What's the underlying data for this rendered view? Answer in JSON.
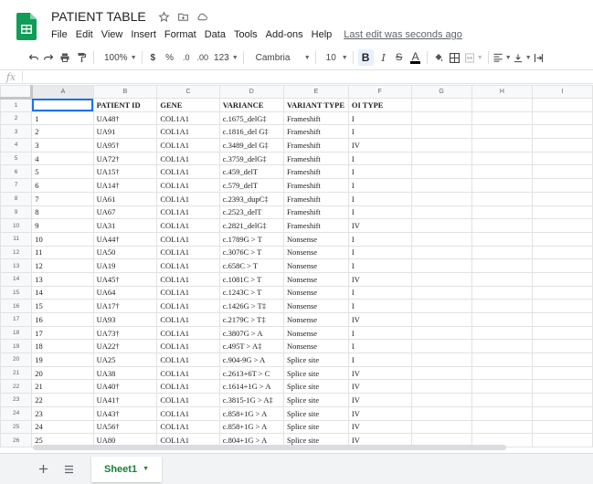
{
  "app": {
    "icon": "sheets-logo",
    "accent_color": "#0f9d58",
    "title": "PATIENT TABLE",
    "title_icons": [
      "star-icon",
      "folder-icon",
      "cloud-icon"
    ]
  },
  "menu": {
    "items": [
      "File",
      "Edit",
      "View",
      "Insert",
      "Format",
      "Data",
      "Tools",
      "Add-ons",
      "Help"
    ],
    "last_edit": "Last edit was seconds ago"
  },
  "toolbar": {
    "zoom": "100%",
    "currency": "$",
    "percent": "%",
    "decimal_decrease": ".0",
    "decimal_increase": ".00",
    "more_formats": "123",
    "font": "Cambria",
    "font_size": "10",
    "bold": "B",
    "italic": "I",
    "strikethrough": "S",
    "text_color": "A"
  },
  "formula_bar": {
    "fx": "fx",
    "value": ""
  },
  "grid": {
    "columns": [
      "A",
      "B",
      "C",
      "D",
      "E",
      "F",
      "G",
      "H",
      "I"
    ],
    "header_row": [
      "",
      "PATIENT ID",
      "GENE",
      "VARIANCE",
      "VARIANT TYPE",
      "OI TYPE"
    ],
    "rows": [
      [
        "1",
        "UA48†",
        "COL1A1",
        "c.1675_delG‡",
        "Frameshift",
        "I"
      ],
      [
        "2",
        "UA91",
        "COL1A1",
        "c.1816_del G‡",
        "Frameshift",
        "I"
      ],
      [
        "3",
        "UA95†",
        "COL1A1",
        "c.3489_del G‡",
        "Frameshift",
        "IV"
      ],
      [
        "4",
        "UA72†",
        "COL1A1",
        "c.3759_delG‡",
        "Frameshift",
        "I"
      ],
      [
        "5",
        "UA15†",
        "COL1A1",
        "c.459_delT",
        "Frameshift",
        "I"
      ],
      [
        "6",
        "UA14†",
        "COL1A1",
        "c.579_delT",
        "Frameshift",
        "I"
      ],
      [
        "7",
        "UA61",
        "COL1A1",
        "c.2393_dupC‡",
        "Frameshift",
        "I"
      ],
      [
        "8",
        "UA67",
        "COL1A1",
        "c.2523_delT",
        "Frameshift",
        "I"
      ],
      [
        "9",
        "UA31",
        "COL1A1",
        "c.2821_delG‡",
        "Frameshift",
        "IV"
      ],
      [
        "10",
        "UA44†",
        "COL1A1",
        "c.1789G > T",
        "Nonsense",
        "I"
      ],
      [
        "11",
        "UA50",
        "COL1A1",
        "c.3076C > T",
        "Nonsense",
        "I"
      ],
      [
        "12",
        "UA19",
        "COL1A1",
        "c.658C > T",
        "Nonsense",
        "I"
      ],
      [
        "13",
        "UA45†",
        "COL1A1",
        "c.1081C > T",
        "Nonsense",
        "IV"
      ],
      [
        "14",
        "UA64",
        "COL1A1",
        "c.1243C > T",
        "Nonsense",
        "I"
      ],
      [
        "15",
        "UA17†",
        "COL1A1",
        "c.1426G > T‡",
        "Nonsense",
        "I"
      ],
      [
        "16",
        "UA93",
        "COL1A1",
        "c.2179C > T‡",
        "Nonsense",
        "IV"
      ],
      [
        "17",
        "UA73†",
        "COL1A1",
        "c.3807G > A",
        "Nonsense",
        "I"
      ],
      [
        "18",
        "UA22†",
        "COL1A1",
        "c.495T > A‡",
        "Nonsense",
        "I"
      ],
      [
        "19",
        "UA25",
        "COL1A1",
        "c.904-9G > A",
        "Splice site",
        "I"
      ],
      [
        "20",
        "UA38",
        "COL1A1",
        "c.2613+6T > C",
        "Splice site",
        "IV"
      ],
      [
        "21",
        "UA40†",
        "COL1A1",
        "c.1614+1G > A",
        "Splice site",
        "IV"
      ],
      [
        "22",
        "UA41†",
        "COL1A1",
        "c.3815-1G > A‡",
        "Splice site",
        "IV"
      ],
      [
        "23",
        "UA43†",
        "COL1A1",
        "c.858+1G > A",
        "Splice site",
        "IV"
      ],
      [
        "24",
        "UA56†",
        "COL1A1",
        "c.858+1G > A",
        "Splice site",
        "IV"
      ],
      [
        "25",
        "UA80",
        "COL1A1",
        "c.804+1G > A",
        "Splice site",
        "IV"
      ]
    ]
  },
  "sheets": {
    "add_icon": "plus-icon",
    "list_icon": "menu-icon",
    "tabs": [
      "Sheet1"
    ]
  }
}
